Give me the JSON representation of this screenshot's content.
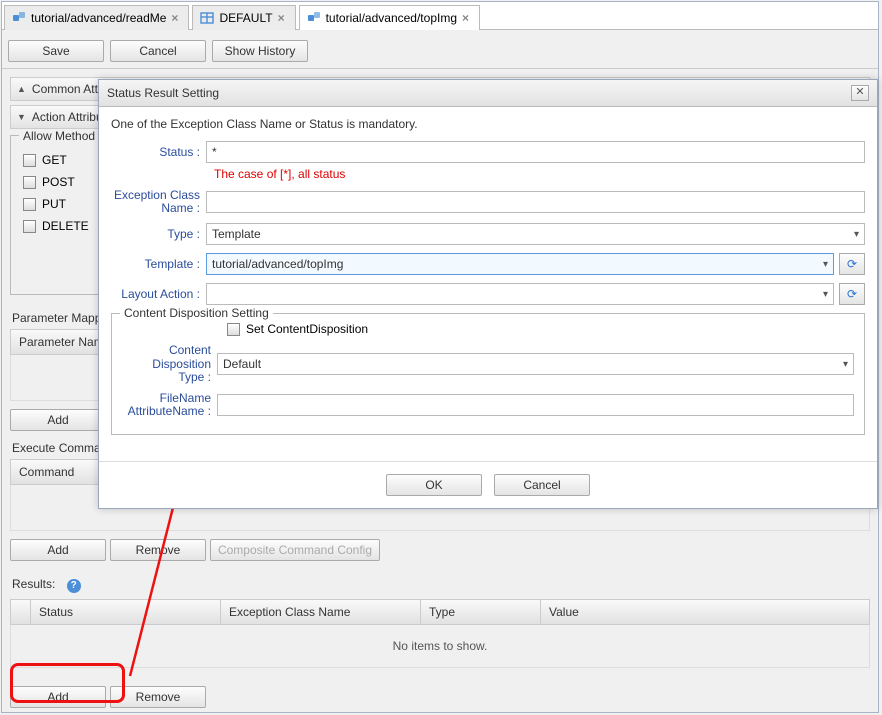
{
  "tabs": [
    {
      "label": "tutorial/advanced/readMe",
      "icon": "entity-icon"
    },
    {
      "label": "DEFAULT",
      "icon": "table-icon"
    },
    {
      "label": "tutorial/advanced/topImg",
      "icon": "entity-icon",
      "active": true
    }
  ],
  "toolbar": {
    "save": "Save",
    "cancel": "Cancel",
    "history": "Show History"
  },
  "sections": {
    "common": "Common Attribute",
    "action": "Action Attribute"
  },
  "allowMethods": {
    "legend": "Allow Method",
    "items": [
      "GET",
      "POST",
      "PUT",
      "DELETE"
    ]
  },
  "paramMap": {
    "label": "Parameter Mapping",
    "header": "Parameter Name",
    "add": "Add"
  },
  "execCmd": {
    "label": "Execute Command",
    "header": "Command",
    "add": "Add",
    "remove": "Remove",
    "composite": "Composite Command Config"
  },
  "results": {
    "label": "Results:",
    "cols": [
      "Status",
      "Exception Class Name",
      "Type",
      "Value"
    ],
    "noitems": "No items to show.",
    "add": "Add",
    "remove": "Remove"
  },
  "dialog": {
    "title": "Status Result Setting",
    "mandatory": "One of the Exception Class Name or Status is mandatory.",
    "labels": {
      "status": "Status :",
      "exClass": "Exception Class\nName :",
      "type": "Type :",
      "template": "Template :",
      "layout": "Layout Action :"
    },
    "values": {
      "status": "*",
      "type": "Template",
      "template": "tutorial/advanced/topImg"
    },
    "hint": "The case of [*], all status",
    "cds": {
      "legend": "Content Disposition Setting",
      "set": "Set ContentDisposition",
      "type_label": "Content Disposition\nType :",
      "type_value": "Default",
      "filename_label": "FileName\nAttributeName :"
    },
    "ok": "OK",
    "cancel": "Cancel"
  }
}
